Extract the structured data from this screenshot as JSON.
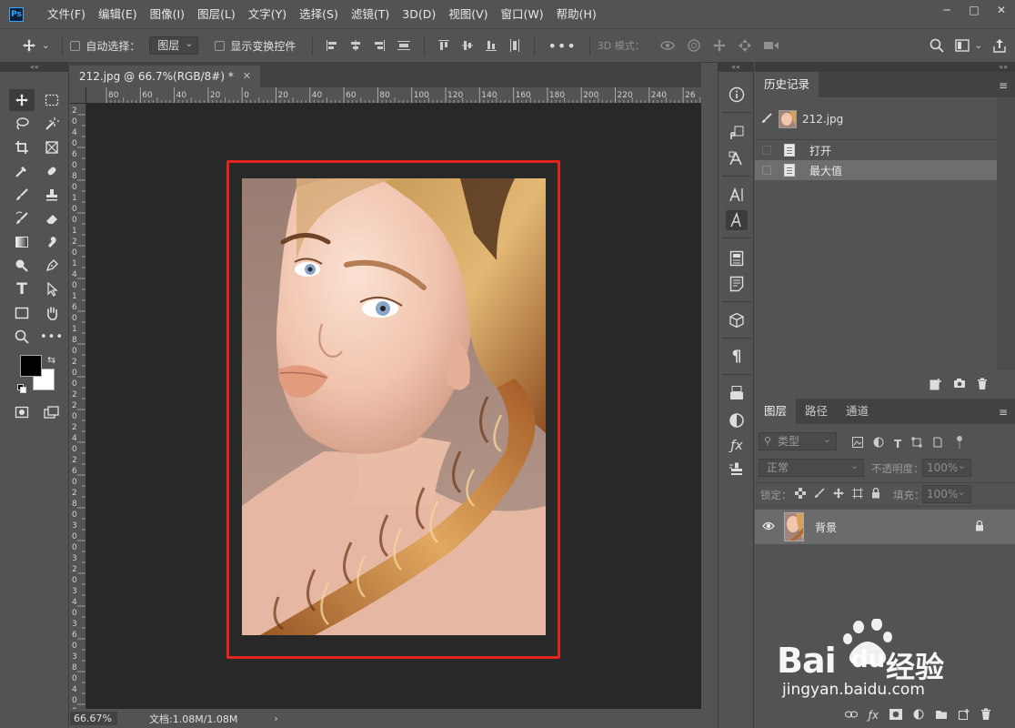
{
  "app": {
    "logo": "Ps"
  },
  "menu": [
    "文件(F)",
    "编辑(E)",
    "图像(I)",
    "图层(L)",
    "文字(Y)",
    "选择(S)",
    "滤镜(T)",
    "3D(D)",
    "视图(V)",
    "窗口(W)",
    "帮助(H)"
  ],
  "window_controls": [
    "─",
    "□",
    "✕"
  ],
  "options": {
    "auto_select_label": "自动选择：",
    "auto_select_value": "图层",
    "transform_label": "显示变换控件",
    "mode_3d_label": "3D 模式："
  },
  "document": {
    "tab_title": "212.jpg @ 66.7%(RGB/8#) *",
    "ruler_top": [
      "80",
      "60",
      "40",
      "20",
      "0",
      "20",
      "40",
      "60",
      "80",
      "100",
      "120",
      "140",
      "160",
      "180",
      "200",
      "220",
      "240",
      "26"
    ],
    "ruler_left": [
      "2",
      "0",
      "4",
      "0",
      "6",
      "0",
      "8",
      "0",
      "1",
      "0",
      "0",
      "1",
      "2",
      "0",
      "1",
      "4",
      "0",
      "1",
      "6",
      "0",
      "1",
      "8",
      "0",
      "2",
      "0",
      "0",
      "2",
      "2",
      "0",
      "2",
      "4",
      "0",
      "2",
      "6",
      "0",
      "2",
      "8",
      "0",
      "3",
      "0",
      "0",
      "3",
      "2",
      "0",
      "3",
      "4",
      "0",
      "3",
      "6",
      "0",
      "3",
      "8",
      "0",
      "4",
      "0",
      "0"
    ]
  },
  "status": {
    "zoom": "66.67%",
    "doc_info": "文档:1.08M/1.08M",
    "arrow": "›"
  },
  "history_panel": {
    "tab": "历史记录",
    "snapshot": "212.jpg",
    "steps": [
      {
        "label": "打开",
        "selected": false
      },
      {
        "label": "最大值",
        "selected": true
      }
    ]
  },
  "layers_panel": {
    "tabs": [
      "图层",
      "路径",
      "通道"
    ],
    "filter_placeholder": "类型",
    "blend_mode": "正常",
    "opacity_label": "不透明度：",
    "opacity_value": "100%",
    "lock_label": "锁定：",
    "fill_label": "填充：",
    "fill_value": "100%",
    "layer_name": "背景"
  },
  "watermark": {
    "brand": "Bai",
    "brand2": "du",
    "cn": "经验",
    "url": "jingyan.baidu.com"
  },
  "colors": {
    "accent_red": "#e3231e",
    "panel_bg": "#535353",
    "canvas_bg": "#282828"
  }
}
